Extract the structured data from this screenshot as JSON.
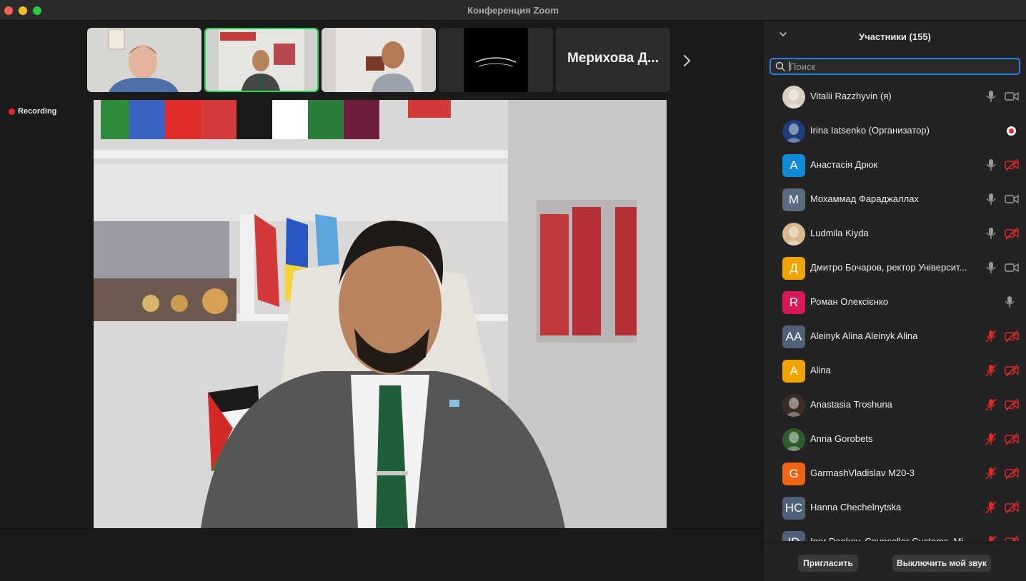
{
  "window": {
    "title": "Конференция Zoom"
  },
  "stage": {
    "recording_label": "Recording",
    "thumbnails": [
      {
        "name": "",
        "active": false
      },
      {
        "name": "",
        "active": true
      },
      {
        "name": "",
        "active": false
      },
      {
        "name": "",
        "active": false
      },
      {
        "name": "Мерихова Д...",
        "active": false
      }
    ]
  },
  "panel": {
    "title": "Участники (155)",
    "search_placeholder": "Поиск",
    "participants": [
      {
        "name": "Vitalii Razzhyvin (я)",
        "avatar": "",
        "avatar_color": "#d9cfc3",
        "mic": "on",
        "cam": "on"
      },
      {
        "name": "Irina Iatsenko (Организатор)",
        "avatar": "",
        "avatar_color": "#1d3e7a",
        "mic": "none",
        "cam": "recording"
      },
      {
        "name": "Анастасія Дрюк",
        "avatar": "A",
        "avatar_color": "#0e8ad6",
        "mic": "on",
        "cam": "off"
      },
      {
        "name": "Мохаммад Фараджаллах",
        "avatar": "M",
        "avatar_color": "#5a6b80",
        "mic": "on",
        "cam": "on"
      },
      {
        "name": "Ludmila Kiyda",
        "avatar": "",
        "avatar_color": "#d9b98f",
        "mic": "on",
        "cam": "off"
      },
      {
        "name": "Дмитро Бочаров, ректор Університ...",
        "avatar": "Д",
        "avatar_color": "#f0a400",
        "mic": "on",
        "cam": "on"
      },
      {
        "name": "Роман Олексієнко",
        "avatar": "R",
        "avatar_color": "#d8185a",
        "mic": "on",
        "cam": "none"
      },
      {
        "name": "Aleinyk Alina Aleinyk Alina",
        "avatar": "AA",
        "avatar_color": "#4e6179",
        "mic": "off",
        "cam": "off"
      },
      {
        "name": "Alina",
        "avatar": "A",
        "avatar_color": "#f0a400",
        "mic": "off",
        "cam": "off"
      },
      {
        "name": "Anastasia Troshuna",
        "avatar": "",
        "avatar_color": "#3b2c26",
        "mic": "off",
        "cam": "off"
      },
      {
        "name": "Anna Gorobets",
        "avatar": "",
        "avatar_color": "#2f5b2a",
        "mic": "off",
        "cam": "off"
      },
      {
        "name": "GarmashVladislav M20-3",
        "avatar": "G",
        "avatar_color": "#f06416",
        "mic": "off",
        "cam": "off"
      },
      {
        "name": "Hanna Chechelnytska",
        "avatar": "HC",
        "avatar_color": "#4e6179",
        "mic": "off",
        "cam": "off"
      },
      {
        "name": "Igor Dankov, Counseller Customs, Mi...",
        "avatar": "ID",
        "avatar_color": "#4e6179",
        "mic": "off",
        "cam": "off"
      }
    ],
    "invite_label": "Пригласить",
    "mute_me_label": "Выключить мой звук"
  }
}
